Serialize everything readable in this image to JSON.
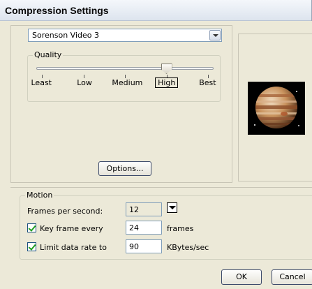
{
  "window": {
    "title": "Compression Settings"
  },
  "compressor": {
    "selected": "Sorenson Video 3"
  },
  "quality": {
    "legend": "Quality",
    "levels": [
      "Least",
      "Low",
      "Medium",
      "High",
      "Best"
    ],
    "selected": "High",
    "slider_fraction": 0.75
  },
  "options_button": {
    "label": "Options..."
  },
  "preview": {
    "icon": "jupiter-preview-image"
  },
  "motion": {
    "legend": "Motion",
    "fps_label": "Frames per second:",
    "fps_value": "12",
    "keyframe_label": "Key frame every",
    "keyframe_checked": true,
    "keyframe_value": "24",
    "keyframe_unit": "frames",
    "datarate_label": "Limit data rate to",
    "datarate_checked": true,
    "datarate_value": "90",
    "datarate_unit": "KBytes/sec"
  },
  "buttons": {
    "ok": "OK",
    "cancel": "Cancel"
  }
}
